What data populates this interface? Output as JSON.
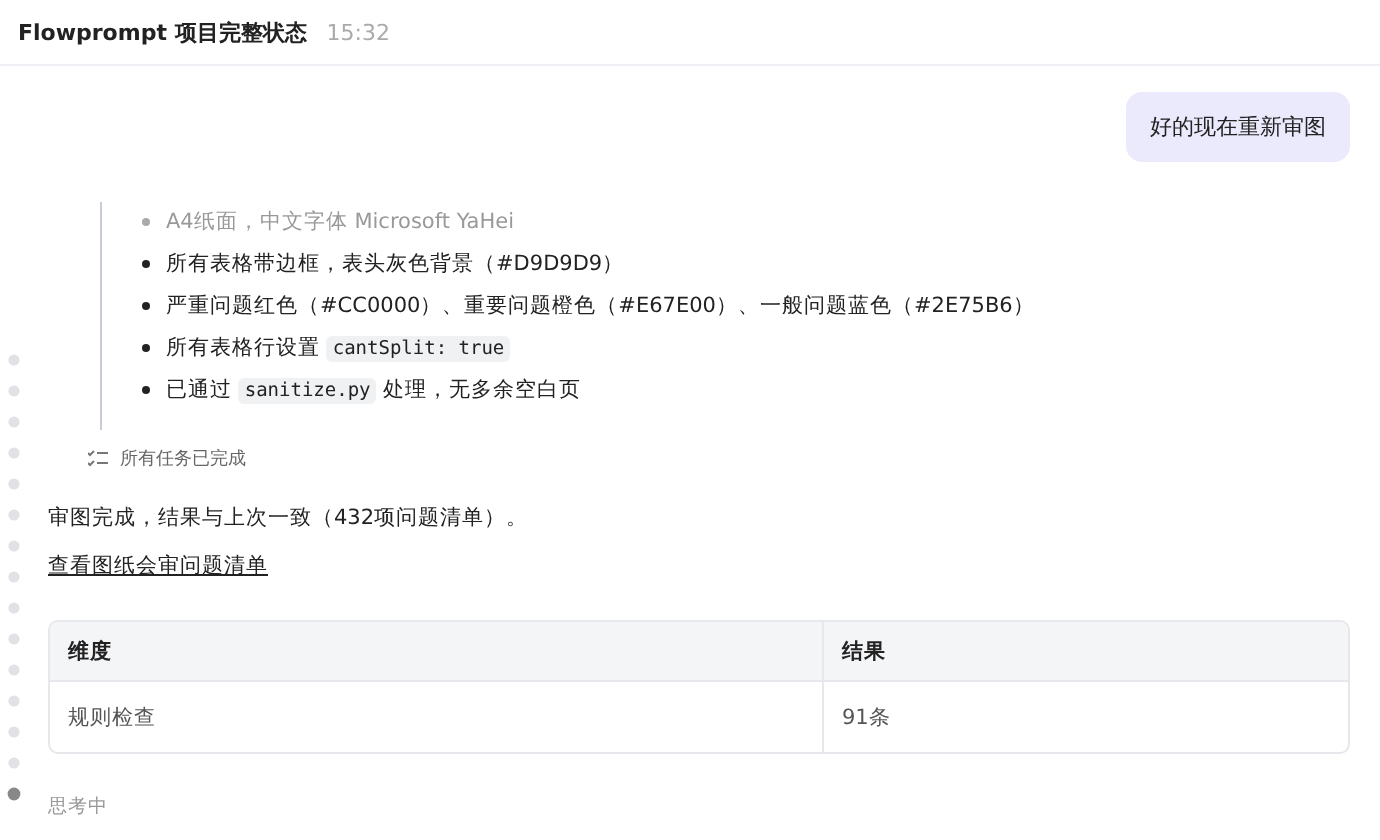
{
  "header": {
    "title": "Flowprompt 项目完整状态",
    "time": "15:32"
  },
  "user_message": "好的现在重新审图",
  "checklist": [
    {
      "faded": true,
      "segments": [
        {
          "kind": "text",
          "text": "A4纸面，中文字体 Microsoft YaHei"
        }
      ]
    },
    {
      "faded": false,
      "segments": [
        {
          "kind": "text",
          "text": "所有表格带边框，表头灰色背景（#D9D9D9）"
        }
      ]
    },
    {
      "faded": false,
      "segments": [
        {
          "kind": "text",
          "text": "严重问题红色（#CC0000）、重要问题橙色（#E67E00）、一般问题蓝色（#2E75B6）"
        }
      ]
    },
    {
      "faded": false,
      "segments": [
        {
          "kind": "text",
          "text": "所有表格行设置 "
        },
        {
          "kind": "code",
          "text": "cantSplit: true"
        }
      ]
    },
    {
      "faded": false,
      "segments": [
        {
          "kind": "text",
          "text": "已通过 "
        },
        {
          "kind": "code",
          "text": "sanitize.py"
        },
        {
          "kind": "text",
          "text": " 处理，无多余空白页"
        }
      ]
    }
  ],
  "task_status": "所有任务已完成",
  "summary": "审图完成，结果与上次一致（432项问题清单）。",
  "link": "查看图纸会审问题清单",
  "table": {
    "columns": [
      "维度",
      "结果"
    ],
    "rows": [
      [
        "规则检查",
        "91条"
      ]
    ]
  },
  "thinking": "思考中"
}
